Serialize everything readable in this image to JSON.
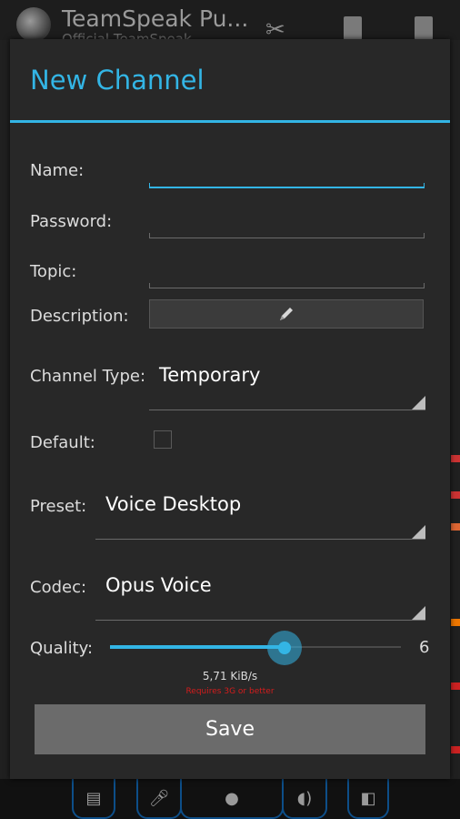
{
  "background_app": {
    "title": "TeamSpeak Pu...",
    "subtitle": "Official TeamSpeak",
    "icons": [
      "teamspeak-logo",
      "tools-icon",
      "bookmark-add-icon",
      "bookmark-icon"
    ],
    "bottom_icons": [
      "chat-icon",
      "mic-icon",
      "mic-mute-icon",
      "speaker-icon",
      "away-icon"
    ]
  },
  "dialog": {
    "title": "New Channel",
    "fields": {
      "name_label": "Name:",
      "name_value": "",
      "password_label": "Password:",
      "password_value": "",
      "topic_label": "Topic:",
      "topic_value": "",
      "description_label": "Description:",
      "description_icon": "pencil-icon",
      "channel_type_label": "Channel Type:",
      "channel_type_value": "Temporary",
      "default_label": "Default:",
      "default_checked": false,
      "preset_label": "Preset:",
      "preset_value": "Voice Desktop",
      "codec_label": "Codec:",
      "codec_value": "Opus Voice",
      "quality_label": "Quality:",
      "quality_value": "6",
      "quality_fraction": 0.6,
      "bitrate_text": "5,71 KiB/s",
      "requirement_text": "Requires 3G or better"
    },
    "save_label": "Save"
  },
  "colors": {
    "accent": "#33b5e5",
    "warning": "#d41c1c",
    "dialog_bg": "#282828"
  }
}
